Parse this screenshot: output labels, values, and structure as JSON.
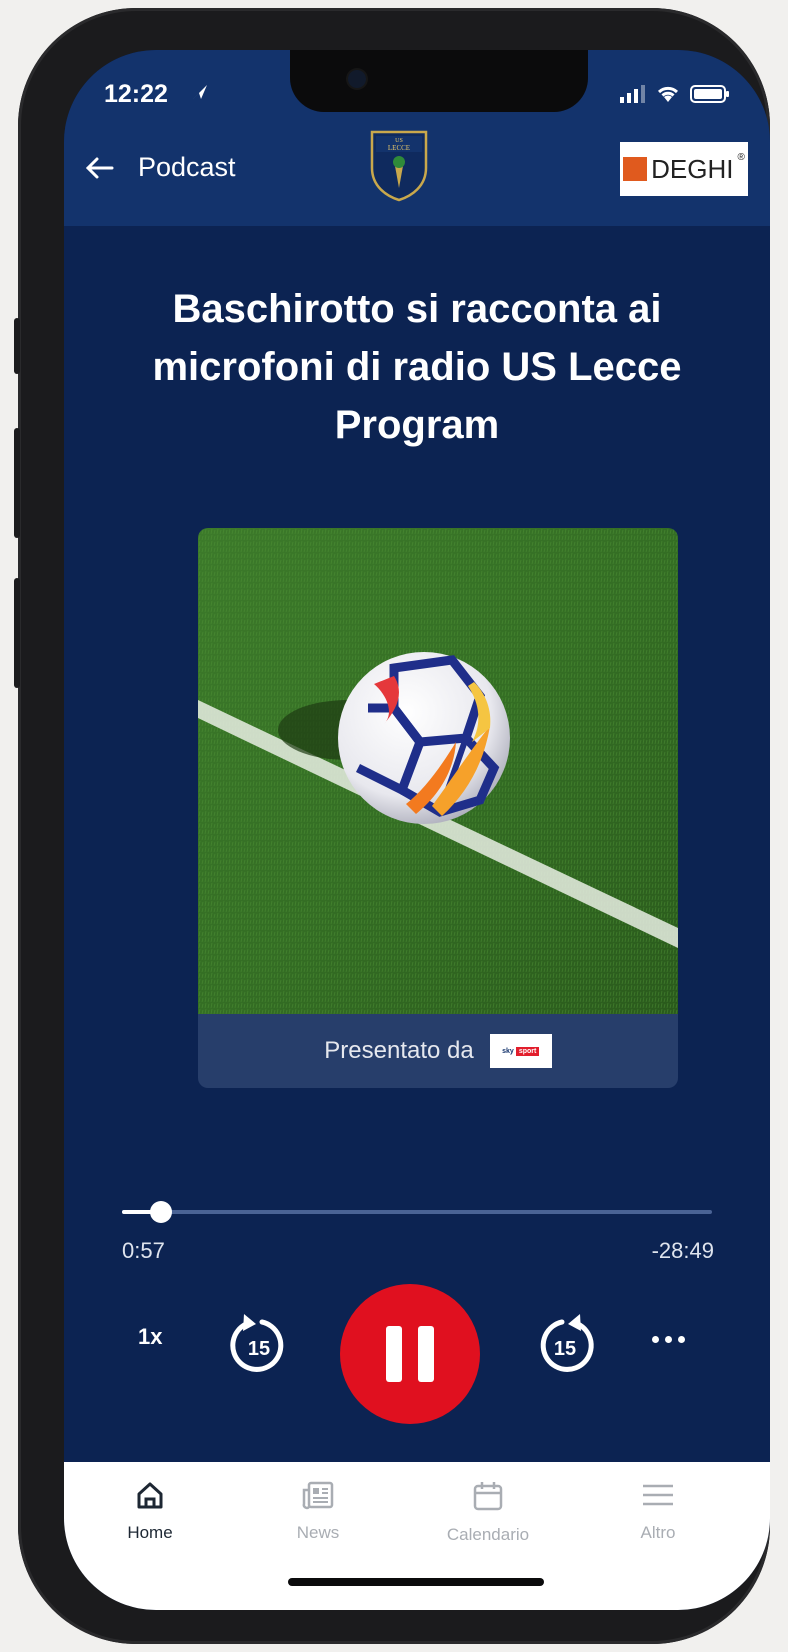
{
  "status_bar": {
    "time": "12:22"
  },
  "header": {
    "back_label": "Podcast",
    "club_logo": "US LECCE",
    "sponsor_name": "DEGHI"
  },
  "episode": {
    "title": "Baschirotto si racconta ai microfoni di radio US Lecce Program",
    "presented_by": "Presentato da",
    "presenter_logo": "sky sport"
  },
  "player": {
    "elapsed": "0:57",
    "remaining": "-28:49",
    "progress_fraction": 0.066,
    "speed": "1x",
    "skip_back_seconds": "15",
    "skip_forward_seconds": "15"
  },
  "tabbar": {
    "items": [
      {
        "label": "Home",
        "icon": "home-icon",
        "active": true
      },
      {
        "label": "News",
        "icon": "news-icon",
        "active": false
      },
      {
        "label": "Calendario",
        "icon": "calendar-icon",
        "active": false
      },
      {
        "label": "Altro",
        "icon": "menu-icon",
        "active": false
      }
    ]
  },
  "colors": {
    "header": "#13336c",
    "background": "#0c2352",
    "accent": "#e0101f"
  }
}
